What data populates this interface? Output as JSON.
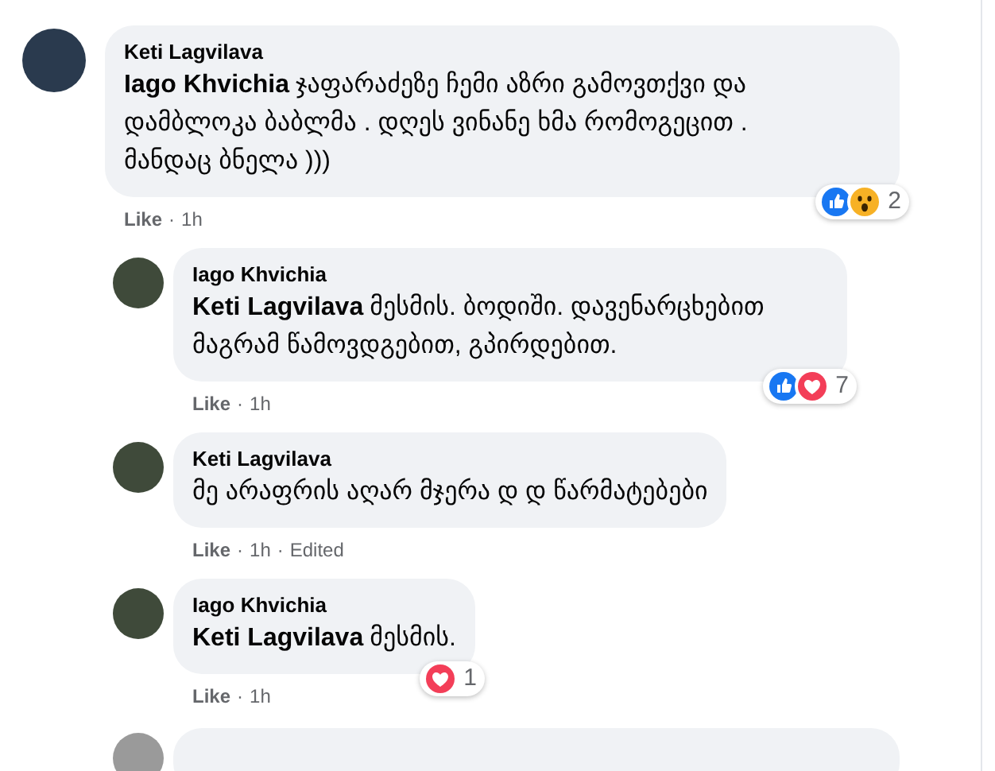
{
  "separator": "·",
  "comments": [
    {
      "kind": "top",
      "author": "Keti Lagvilava",
      "mention": "Iago Khvichia",
      "text": "ჯაფარაძეზე ჩემი აზრი გამოვთქვი და დამბლოკა ბაბლმა . დღეს ვინანე ხმა რომოგეცით . მანდაც ბნელა )))",
      "like": "Like",
      "time": "1h",
      "reactions": [
        {
          "kind": "like"
        },
        {
          "kind": "wow"
        }
      ],
      "count": "2"
    },
    {
      "kind": "reply",
      "author": "Iago Khvichia",
      "mention": "Keti Lagvilava",
      "text": "მესმის. ბოდიში. დავენარცხებით მაგრამ წამოვდგებით, გპირდებით.",
      "like": "Like",
      "time": "1h",
      "reactions": [
        {
          "kind": "like"
        },
        {
          "kind": "love"
        }
      ],
      "count": "7"
    },
    {
      "kind": "reply",
      "author": "Keti Lagvilava",
      "text": "მე არაფრის აღარ მჯერა დ დ წარმატებები",
      "like": "Like",
      "time": "1h",
      "edited": "Edited"
    },
    {
      "kind": "reply",
      "author": "Iago Khvichia",
      "mention": "Keti Lagvilava",
      "text": "მესმის.",
      "like": "Like",
      "time": "1h",
      "reactions": [
        {
          "kind": "love"
        }
      ],
      "count": "1"
    }
  ]
}
